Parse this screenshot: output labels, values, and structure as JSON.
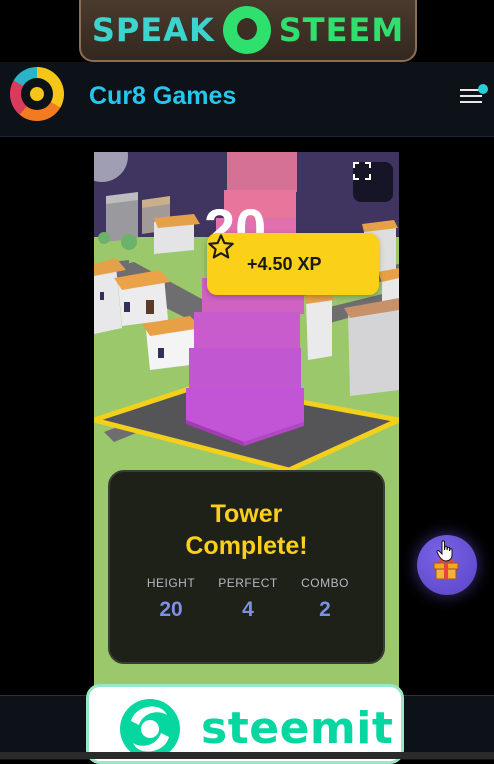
{
  "top_banner": {
    "word_left": "SPEAK",
    "word_right": "STEEM",
    "logo_icon": "speak-steem-logo-icon"
  },
  "header": {
    "title": "Cur8 Games",
    "logo_icon": "cur8-logo-icon",
    "menu_icon": "hamburger-menu-icon"
  },
  "game": {
    "score": "20",
    "xp_reward": "+4.50 XP",
    "result": {
      "title_line1": "Tower",
      "title_line2": "Complete!",
      "stats": [
        {
          "label": "HEIGHT",
          "value": "20"
        },
        {
          "label": "PERFECT",
          "value": "4"
        },
        {
          "label": "COMBO",
          "value": "2"
        }
      ]
    }
  },
  "floating_button": {
    "icon": "gift-icon"
  },
  "bottom_banner": {
    "word": "steemit",
    "logo_icon": "steemit-logo-icon"
  },
  "colors": {
    "accent_title": "#27c7ec",
    "xp_badge": "#fbd018",
    "result_title": "#fbcf1a",
    "stat_value": "#7d8fe8",
    "steemit": "#06d6a0"
  }
}
